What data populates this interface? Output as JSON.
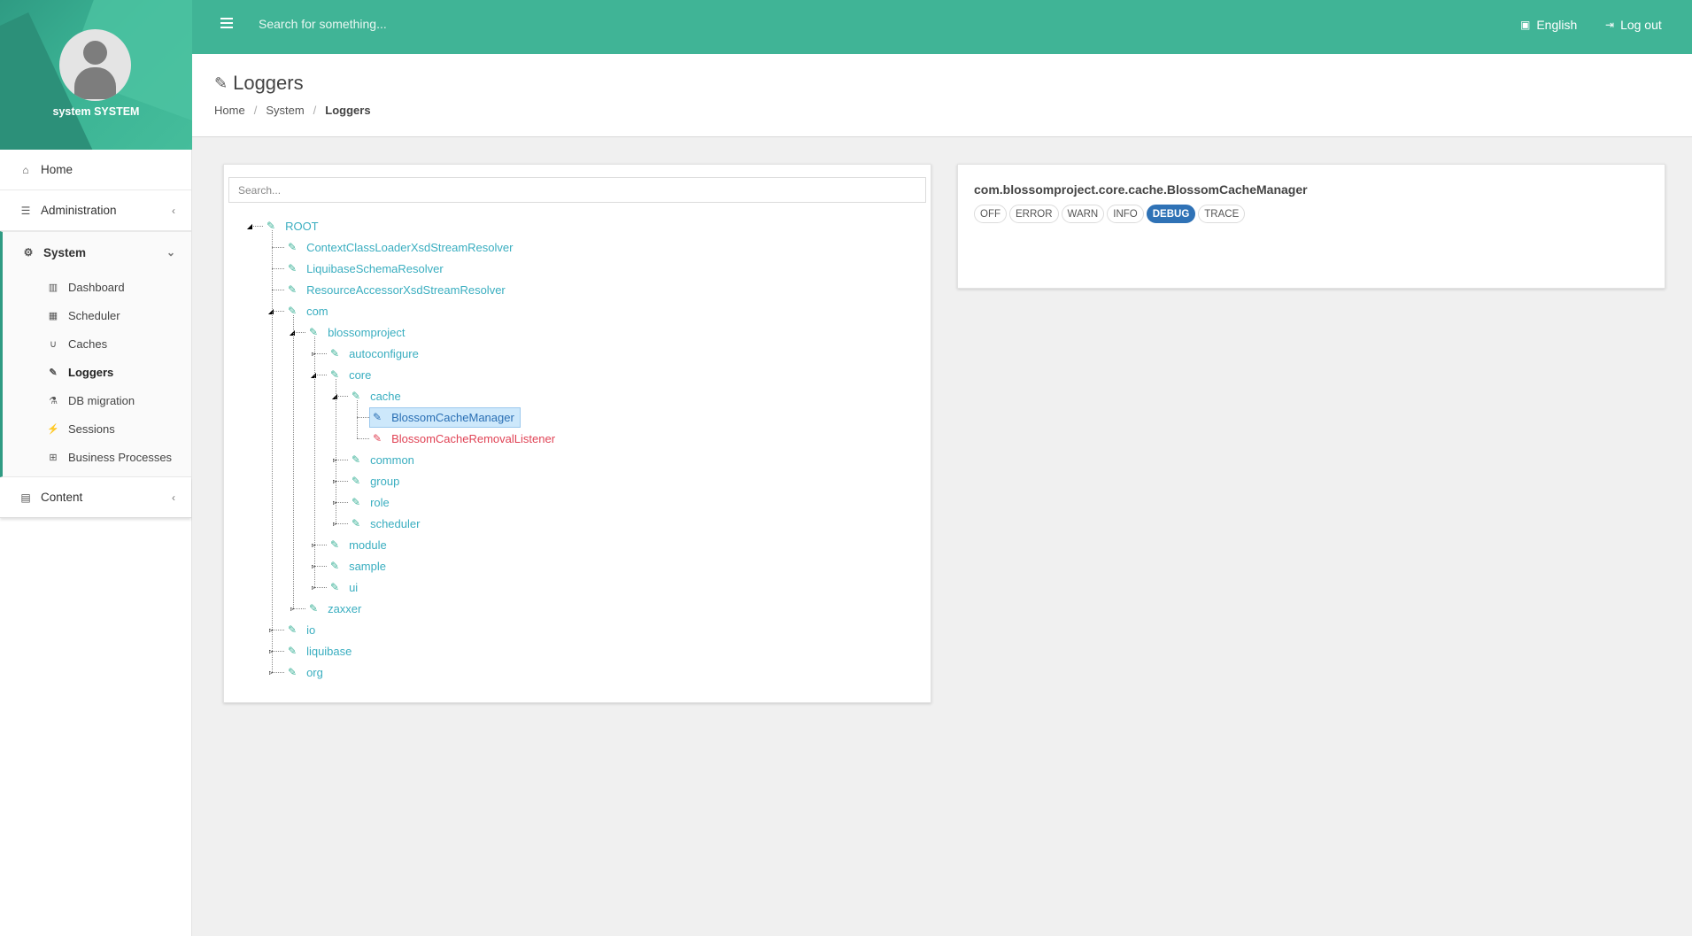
{
  "profile": {
    "name": "system SYSTEM"
  },
  "topbar": {
    "search_placeholder": "Search for something...",
    "language": "English",
    "logout": "Log out"
  },
  "sidebar": {
    "home": "Home",
    "administration": "Administration",
    "system": "System",
    "system_items": [
      "Dashboard",
      "Scheduler",
      "Caches",
      "Loggers",
      "DB migration",
      "Sessions",
      "Business Processes"
    ],
    "content": "Content"
  },
  "page": {
    "title": "Loggers",
    "breadcrumb": [
      "Home",
      "System",
      "Loggers"
    ]
  },
  "tree": {
    "search_placeholder": "Search...",
    "nodes": [
      {
        "label": "ROOT"
      },
      {
        "label": "ContextClassLoaderXsdStreamResolver"
      },
      {
        "label": "LiquibaseSchemaResolver"
      },
      {
        "label": "ResourceAccessorXsdStreamResolver"
      },
      {
        "label": "com"
      },
      {
        "label": "blossomproject"
      },
      {
        "label": "autoconfigure"
      },
      {
        "label": "core"
      },
      {
        "label": "cache"
      },
      {
        "label": "BlossomCacheManager"
      },
      {
        "label": "BlossomCacheRemovalListener"
      },
      {
        "label": "common"
      },
      {
        "label": "group"
      },
      {
        "label": "role"
      },
      {
        "label": "scheduler"
      },
      {
        "label": "module"
      },
      {
        "label": "sample"
      },
      {
        "label": "ui"
      },
      {
        "label": "zaxxer"
      },
      {
        "label": "io"
      },
      {
        "label": "liquibase"
      },
      {
        "label": "org"
      }
    ]
  },
  "detail": {
    "logger_name": "com.blossomproject.core.cache.BlossomCacheManager",
    "levels": [
      "OFF",
      "ERROR",
      "WARN",
      "INFO",
      "DEBUG",
      "TRACE"
    ],
    "selected_level": "DEBUG"
  },
  "colors": {
    "topbar": "#40b496",
    "accent": "#3fb39a",
    "link": "#3aaec0",
    "selected_level": "#2f72b6",
    "error_node": "#e04355"
  }
}
